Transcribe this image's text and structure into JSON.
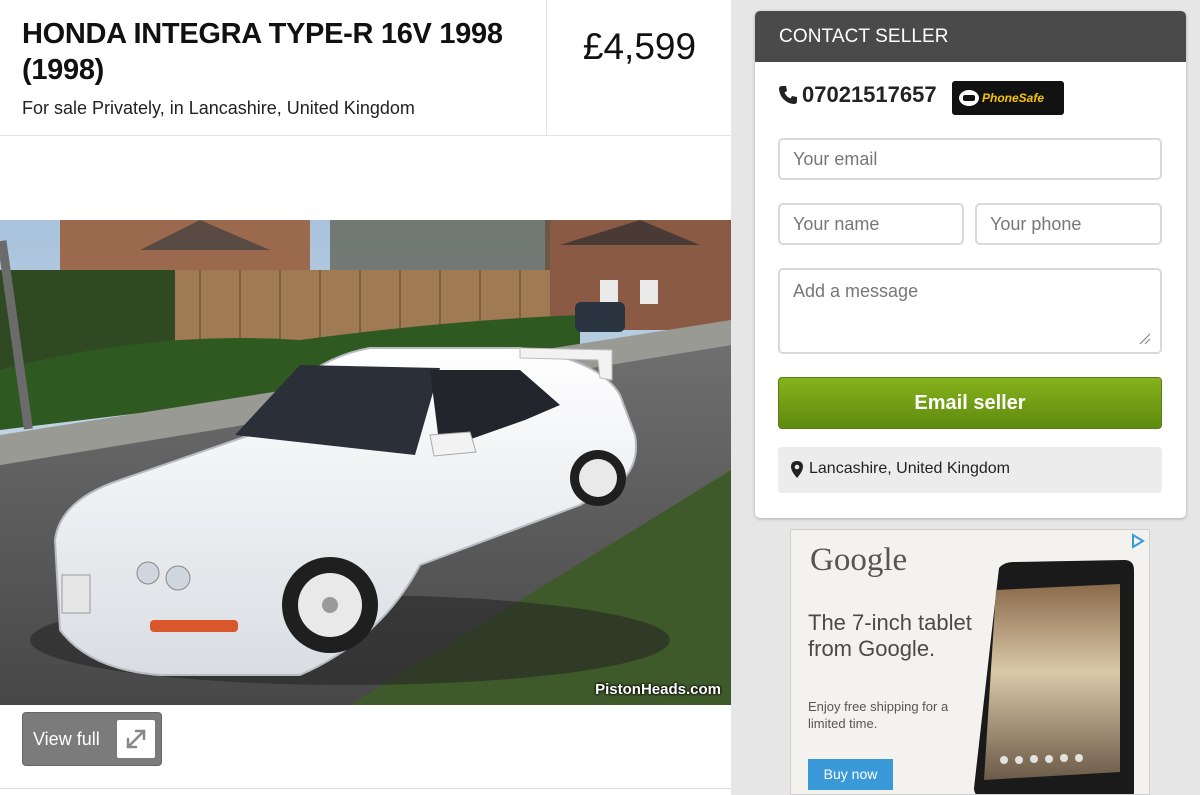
{
  "listing": {
    "title": "HONDA INTEGRA TYPE-R 16V 1998 (1998)",
    "subtitle": "For sale Privately, in Lancashire, United Kingdom",
    "price": "£4,599",
    "photo_watermark": "PistonHeads.com",
    "view_full_label": "View full",
    "photo_icon": "expand-icon"
  },
  "contact": {
    "header": "CONTACT SELLER",
    "phone_number": "07021517657",
    "phone_icon": "phone-icon",
    "phonesafe_label": "PhoneSafe",
    "email_placeholder": "Your email",
    "name_placeholder": "Your name",
    "phone_placeholder": "Your phone",
    "message_placeholder": "Add a message",
    "submit_label": "Email seller",
    "location_icon": "map-pin-icon",
    "location": "Lancashire, United Kingdom"
  },
  "ad": {
    "brand": "Google",
    "headline": "The 7-inch tablet from Google.",
    "body": "Enjoy free shipping for a limited time.",
    "cta": "Buy now",
    "adchoices_icon": "adchoices-icon"
  },
  "colors": {
    "contact_header_bg": "#4a4a4a",
    "button_green": "#6e9c14",
    "ad_button_blue": "#3a9ad9",
    "phonesafe_yellow": "#f5c400"
  }
}
